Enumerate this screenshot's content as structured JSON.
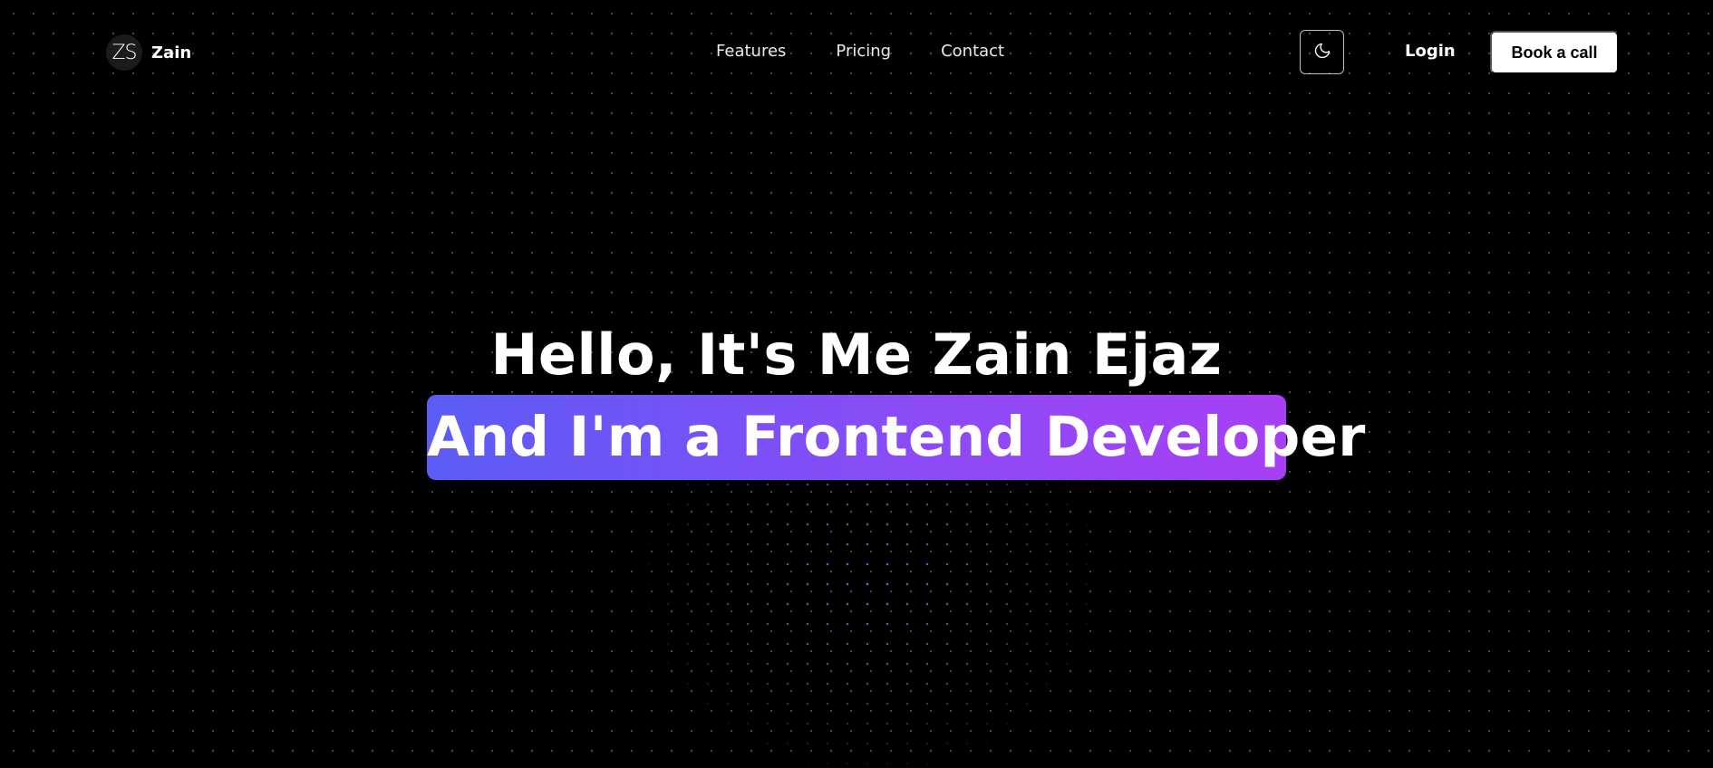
{
  "nav": {
    "logo_monogram": "ZS",
    "brand_name": "Zain",
    "links": [
      {
        "label": "Features"
      },
      {
        "label": "Pricing"
      },
      {
        "label": "Contact"
      }
    ],
    "theme_toggle_icon": "moon-icon",
    "login_label": "Login",
    "cta_label": "Book a call"
  },
  "hero": {
    "title": "Hello, It's Me Zain Ejaz",
    "highlight": "And I'm a Frontend Developer"
  },
  "colors": {
    "background": "#000000",
    "highlight_gradient_start": "#5b5cf6",
    "highlight_gradient_end": "#a73ff5",
    "cta_background": "#ffffff"
  }
}
